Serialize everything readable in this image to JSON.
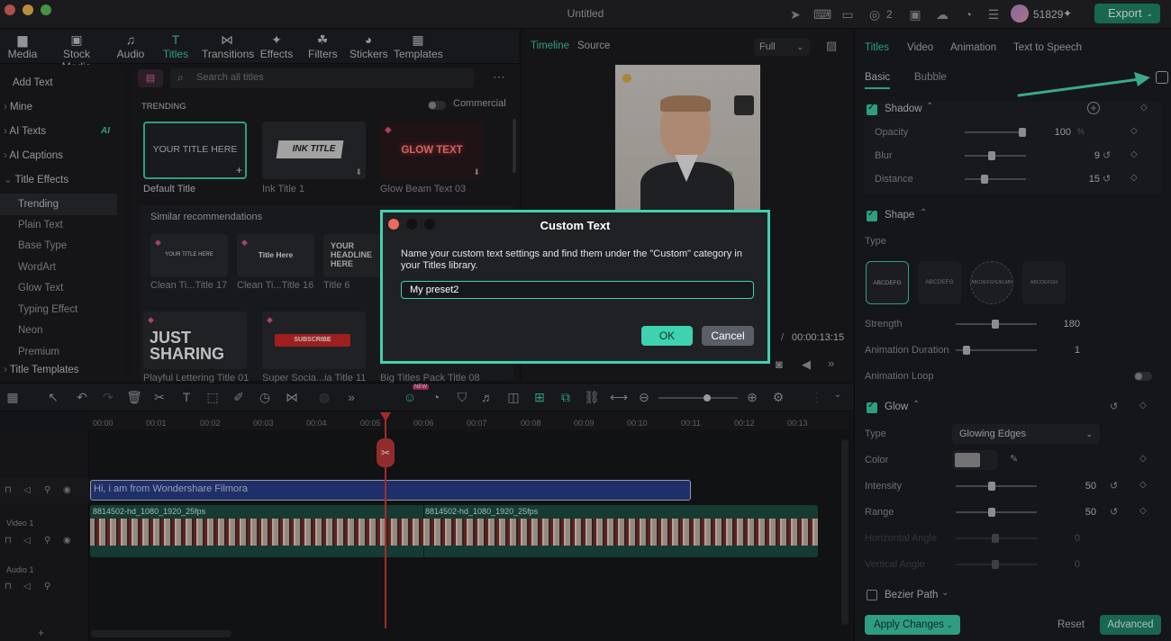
{
  "window": {
    "title": "Untitled",
    "credits": "51829",
    "export_label": "Export",
    "badge_count": "2"
  },
  "toolbar": {
    "tabs": [
      {
        "label": "Media",
        "icon": "▆"
      },
      {
        "label": "Stock Media",
        "icon": "▣"
      },
      {
        "label": "Audio",
        "icon": "♫"
      },
      {
        "label": "Titles",
        "icon": "T"
      },
      {
        "label": "Transitions",
        "icon": "⋈"
      },
      {
        "label": "Effects",
        "icon": "✦"
      },
      {
        "label": "Filters",
        "icon": "☘"
      },
      {
        "label": "Stickers",
        "icon": "◕"
      },
      {
        "label": "Templates",
        "icon": "▦"
      }
    ]
  },
  "categories": {
    "add_text": "Add Text",
    "items": [
      "Mine",
      "AI Texts",
      "AI Captions",
      "Title Effects"
    ],
    "ai_badge": "AI",
    "sub": [
      "Trending",
      "Plain Text",
      "Base Type",
      "WordArt",
      "Glow Text",
      "Typing Effect",
      "Neon",
      "Premium"
    ],
    "title_templates": "Title Templates"
  },
  "grid": {
    "search_placeholder": "Search all titles",
    "commercial": "Commercial",
    "trending": "TRENDING",
    "similar": "Similar recommendations",
    "cards": [
      {
        "caption": "Default Title",
        "thumb": "YOUR TITLE HERE"
      },
      {
        "caption": "Ink Title 1",
        "thumb": "INK TITLE"
      },
      {
        "caption": "Glow Beam Text 03",
        "thumb": "GLOW TEXT"
      },
      {
        "caption": "Clean Ti...Title 17",
        "thumb": "YOUR TITLE HERE"
      },
      {
        "caption": "Clean Ti...Title 16",
        "thumb": "Title Here"
      },
      {
        "caption": "Title 6",
        "thumb": "YOUR HEADLINE HERE"
      },
      {
        "caption": "Playful Lettering Title 01",
        "thumb": "JUST SHARING"
      },
      {
        "caption": "Super Socia...ia Title 11",
        "thumb": "SUBSCRIBE"
      },
      {
        "caption": "Big Titles Pack Title 08",
        "thumb": ""
      }
    ]
  },
  "preview": {
    "tab_timeline": "Timeline",
    "tab_source": "Source",
    "quality": "Full",
    "time": "00:00:13:15",
    "slash": "/"
  },
  "right": {
    "tabs": [
      "Titles",
      "Video",
      "Animation",
      "Text to Speech"
    ],
    "subtabs": [
      "Basic",
      "Bubble"
    ],
    "shadow": {
      "title": "Shadow",
      "opacity_label": "Opacity",
      "opacity": "100",
      "opacity_unit": "%",
      "blur_label": "Blur",
      "blur": "9",
      "distance_label": "Distance",
      "distance": "15"
    },
    "shape": {
      "title": "Shape",
      "type_label": "Type",
      "strength_label": "Strength",
      "strength": "180",
      "anim_dur_label": "Animation Duration",
      "anim_dur": "1",
      "anim_loop_label": "Animation Loop",
      "samples": [
        "ABCDEFG",
        "ABCDEFG",
        "ABCDEFGHIJKLMN",
        "ABCDEFGH"
      ]
    },
    "glow": {
      "title": "Glow",
      "type_label": "Type",
      "type_value": "Glowing Edges",
      "color_label": "Color",
      "intensity_label": "Intensity",
      "intensity": "50",
      "range_label": "Range",
      "range": "50",
      "hangle_label": "Horizontal Angle",
      "hangle": "0",
      "vangle_label": "Vertical Angle",
      "vangle": "0"
    },
    "bezier": "Bezier Path",
    "apply": "Apply Changes",
    "reset": "Reset",
    "advanced": "Advanced"
  },
  "timeline": {
    "ticks": [
      "00:00",
      "00:01",
      "00:02",
      "00:03",
      "00:04",
      "00:05",
      "00:06",
      "00:07",
      "00:08",
      "00:09",
      "00:10",
      "00:11",
      "00:12",
      "00:13"
    ],
    "text_clip": "Hi, i am from Wondershare Filmora",
    "video_clip_1": "8814502-hd_1080_1920_25fps",
    "video_clip_2": "8814502-hd_1080_1920_25fps",
    "video_track": "Video 1",
    "audio_track": "Audio 1",
    "new_badge": "NEW"
  },
  "dialog": {
    "title": "Custom Text",
    "description": "Name your custom text settings and find them under the \"Custom\" category in your Titles library.",
    "input_value": "My preset2",
    "ok": "OK",
    "cancel": "Cancel"
  },
  "colors": {
    "accent": "#3fd2ae",
    "bg": "#1a1b1f",
    "panel": "#1d1e22",
    "arrow": "#4fe0bd"
  }
}
